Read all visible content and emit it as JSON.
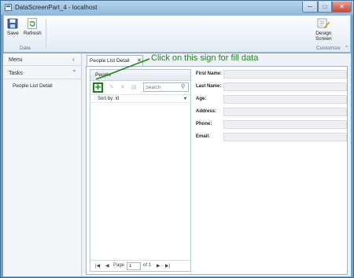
{
  "window": {
    "title": "DataScreenPart_4 - localhost",
    "controls": {
      "minimize": "─",
      "maximize": "□",
      "close": "✕"
    }
  },
  "ribbon": {
    "save_label": "Save",
    "refresh_label": "Refresh",
    "data_group_label": "Data",
    "design_label_1": "Design",
    "design_label_2": "Screen",
    "customize_group_label": "Customize"
  },
  "nav": {
    "menu_label": "Menu",
    "menu_chevron": "‹",
    "tasks_label": "Tasks",
    "tasks_chevron": "⌃",
    "items": [
      {
        "label": "People List Detail"
      }
    ]
  },
  "tab": {
    "label": "People List Detail",
    "close": "✕"
  },
  "list": {
    "header": "People",
    "add_symbol": "✚",
    "edit_symbol": "✎",
    "delete_symbol": "✕",
    "export_symbol": "▤",
    "search_placeholder": "Search",
    "search_icon": "⚲",
    "sort_label": "Sort by: Id",
    "sort_arrow": "▾",
    "pager": {
      "first": "|◀",
      "prev": "◀",
      "page_label": "Page",
      "page_value": "1",
      "of_label": "of 1",
      "next": "▶",
      "last": "▶|"
    }
  },
  "details": {
    "fields": [
      {
        "label": "First Name:"
      },
      {
        "label": "Last Name:"
      },
      {
        "label": "Age:"
      },
      {
        "label": "Address:"
      },
      {
        "label": "Phone:"
      },
      {
        "label": "Email:"
      }
    ]
  },
  "annotation": {
    "text": "Click on this sign for fill data",
    "color": "#1e8a1e"
  },
  "colors": {
    "window_frame": "#6aa3cf",
    "add_button_border": "#1b7d1b",
    "close_button": "#c94733"
  },
  "icons": [
    "app-icon",
    "save-icon",
    "refresh-icon",
    "design-screen-icon",
    "add-icon",
    "edit-icon",
    "delete-icon",
    "export-icon",
    "search-icon"
  ]
}
